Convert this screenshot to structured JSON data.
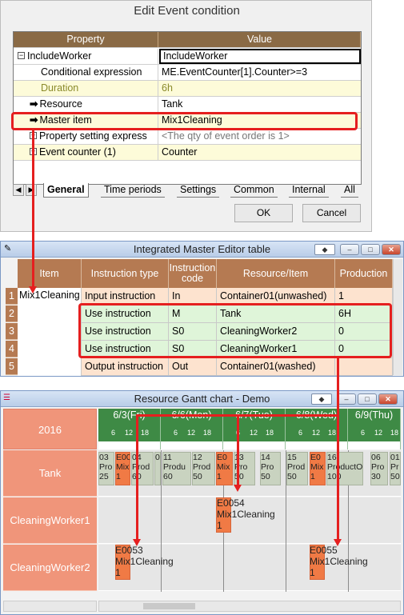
{
  "dialog": {
    "title": "Edit Event condition",
    "grid_header": {
      "property": "Property",
      "value": "Value"
    },
    "rows": [
      {
        "property": "IncludeWorker",
        "value": "IncludeWorker"
      },
      {
        "property": "Conditional expression",
        "value": "ME.EventCounter[1].Counter>=3"
      },
      {
        "property": "Duration",
        "value": "6h"
      },
      {
        "property": "Resource",
        "value": "Tank"
      },
      {
        "property": "Master item",
        "value": "Mix1Cleaning"
      },
      {
        "property": "Property setting express",
        "value": "<The qty of event order is 1>"
      },
      {
        "property": "Event counter (1)",
        "value": "Counter"
      }
    ],
    "tabs": [
      "General",
      "Time periods",
      "Settings",
      "Common",
      "Internal",
      "All"
    ],
    "ok": "OK",
    "cancel": "Cancel"
  },
  "master": {
    "title": "Integrated Master Editor table",
    "headers": [
      "Item",
      "Instruction type",
      "Instruction code",
      "Resource/Item",
      "Production"
    ],
    "item": "Mix1Cleaning",
    "rows": [
      {
        "num": "1",
        "type": "Input instruction",
        "code": "In",
        "resource": "Container01(unwashed)",
        "production": "1"
      },
      {
        "num": "2",
        "type": "Use instruction",
        "code": "M",
        "resource": "Tank",
        "production": "6H"
      },
      {
        "num": "3",
        "type": "Use instruction",
        "code": "S0",
        "resource": "CleaningWorker2",
        "production": "0"
      },
      {
        "num": "4",
        "type": "Use instruction",
        "code": "S0",
        "resource": "CleaningWorker1",
        "production": "0"
      },
      {
        "num": "5",
        "type": "Output instruction",
        "code": "Out",
        "resource": "Container01(washed)",
        "production": ""
      }
    ]
  },
  "gantt": {
    "title": "Resource Gantt chart - Demo",
    "year": "2016",
    "days": [
      "6/3(Fri)",
      "6/6(Mon)",
      "6/7(Tue)",
      "6/8(Wed)",
      "6/9(Thu)"
    ],
    "hours": [
      "6",
      "12",
      "18"
    ],
    "resources": [
      "Tank",
      "CleaningWorker1",
      "CleaningWorker2"
    ],
    "tank_bars": [
      {
        "l1": "03",
        "l2": "Pro",
        "l3": "25"
      },
      {
        "l1": "E00",
        "l2": "Mix",
        "l3": "1"
      },
      {
        "l1": "04",
        "l2": "Prod",
        "l3": "60"
      },
      {
        "l1": "0",
        "l2": "",
        "l3": ""
      },
      {
        "l1": "11",
        "l2": "Produ",
        "l3": "60"
      },
      {
        "l1": "12",
        "l2": "Prod",
        "l3": "50"
      },
      {
        "l1": "E0",
        "l2": "Mix",
        "l3": "1"
      },
      {
        "l1": "13",
        "l2": "Pro",
        "l3": "50"
      },
      {
        "l1": "14",
        "l2": "Pro",
        "l3": "50"
      },
      {
        "l1": "15",
        "l2": "Prod",
        "l3": "50"
      },
      {
        "l1": "E0",
        "l2": "Mix",
        "l3": "1"
      },
      {
        "l1": "16",
        "l2": "ProductO",
        "l3": "100"
      },
      {
        "l1": "06",
        "l2": "Pro",
        "l3": "30"
      },
      {
        "l1": "01",
        "l2": "Pr",
        "l3": "50"
      }
    ],
    "jobs": [
      {
        "id": "E0054",
        "item": "Mix1Cleaning",
        "qty": "1"
      },
      {
        "id": "E0053",
        "item": "Mix1Cleaning",
        "qty": "1"
      },
      {
        "id": "E0055",
        "item": "Mix1Cleaning",
        "qty": "1"
      }
    ]
  }
}
